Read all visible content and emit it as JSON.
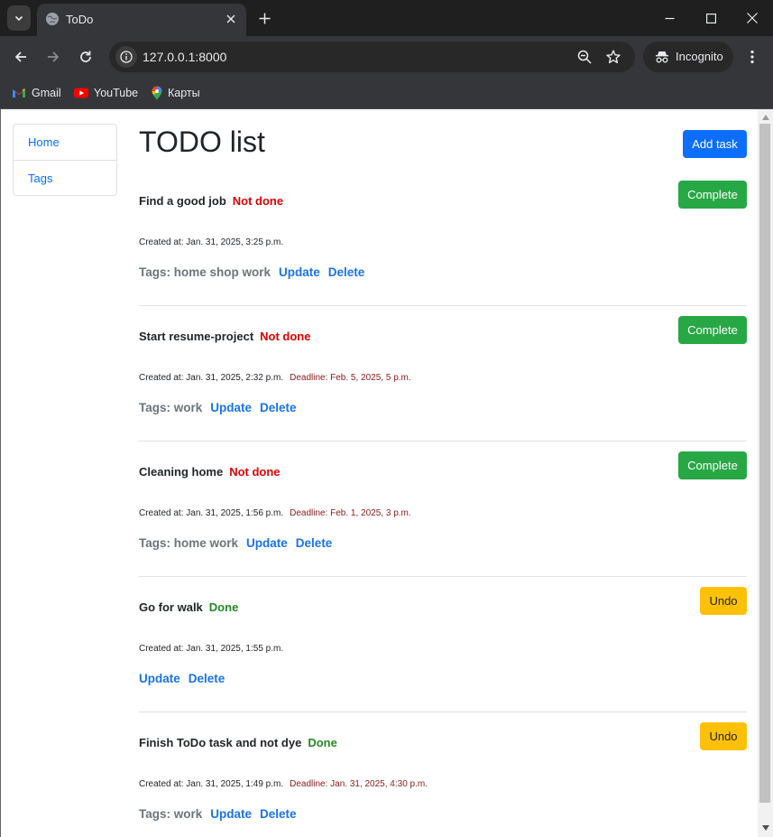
{
  "browser": {
    "tab_title": "ToDo",
    "url": "127.0.0.1:8000",
    "incognito_label": "Incognito",
    "bookmarks": [
      {
        "label": "Gmail",
        "icon": "gmail-icon"
      },
      {
        "label": "YouTube",
        "icon": "youtube-icon"
      },
      {
        "label": "Карты",
        "icon": "maps-icon"
      }
    ]
  },
  "sidebar": {
    "items": [
      {
        "label": "Home"
      },
      {
        "label": "Tags"
      }
    ]
  },
  "main": {
    "title": "TODO list",
    "add_task_label": "Add task",
    "tasks": [
      {
        "name": "Find a good job",
        "status": "Not done",
        "action": "Complete",
        "created": "Created at: Jan. 31, 2025, 3:25 p.m.",
        "deadline": "",
        "tags": "Tags: home shop work",
        "update": "Update",
        "delete": "Delete"
      },
      {
        "name": "Start resume-project",
        "status": "Not done",
        "action": "Complete",
        "created": "Created at: Jan. 31, 2025, 2:32 p.m.",
        "deadline": "Deadline: Feb. 5, 2025, 5 p.m.",
        "tags": "Tags: work",
        "update": "Update",
        "delete": "Delete"
      },
      {
        "name": "Cleaning home",
        "status": "Not done",
        "action": "Complete",
        "created": "Created at: Jan. 31, 2025, 1:56 p.m.",
        "deadline": "Deadline: Feb. 1, 2025, 3 p.m.",
        "tags": "Tags: home work",
        "update": "Update",
        "delete": "Delete"
      },
      {
        "name": "Go for walk",
        "status": "Done",
        "action": "Undo",
        "created": "Created at: Jan. 31, 2025, 1:55 p.m.",
        "deadline": "",
        "tags": "",
        "update": "Update",
        "delete": "Delete"
      },
      {
        "name": "Finish ToDo task and not dye",
        "status": "Done",
        "action": "Undo",
        "created": "Created at: Jan. 31, 2025, 1:49 p.m.",
        "deadline": "Deadline: Jan. 31, 2025, 4:30 p.m.",
        "tags": "Tags: work",
        "update": "Update",
        "delete": "Delete"
      }
    ]
  },
  "colors": {
    "primary": "#0d6efd",
    "success": "#28a745",
    "warning": "#ffc107",
    "not_done": "#dc0000",
    "done": "#238a23",
    "deadline": "#8b1a1a"
  }
}
